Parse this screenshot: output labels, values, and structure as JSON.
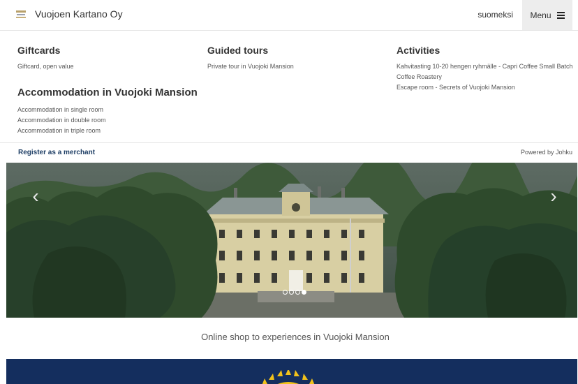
{
  "header": {
    "brand": "Vuojoen Kartano Oy",
    "logo_icon": "manor-logo-icon",
    "language": "suomeksi",
    "menu_label": "Menu",
    "menu_icon": "hamburger-icon"
  },
  "categories": [
    {
      "title": "Giftcards",
      "items": [
        "Giftcard, open value"
      ]
    },
    {
      "title": "Accommodation in Vuojoki Mansion",
      "items": [
        "Accommodation in single room",
        "Accommodation in double room",
        "Accommodation in triple room"
      ]
    },
    {
      "title": "Guided tours",
      "items": [
        "Private tour in Vuojoki Mansion"
      ]
    },
    {
      "title": "Activities",
      "items": [
        "Kahvitasting 10-20 hengen ryhmälle - Capri Coffee Small Batch Coffee Roastery",
        "Escape room - Secrets of Vuojoki Mansion"
      ]
    }
  ],
  "merchant": {
    "register_label": "Register as a merchant",
    "powered_by": "Powered by Johku"
  },
  "carousel": {
    "image": "vuojoki-mansion-aerial-photo",
    "prev_icon": "chevron-left-icon",
    "next_icon": "chevron-right-icon",
    "slide_count": 4,
    "active_slide": 4
  },
  "tagline": "Online shop to experiences in Vuojoki Mansion",
  "footer": {
    "emblem": "sun-emblem-icon",
    "background": "#142e5e",
    "accent": "#f2c21b"
  }
}
